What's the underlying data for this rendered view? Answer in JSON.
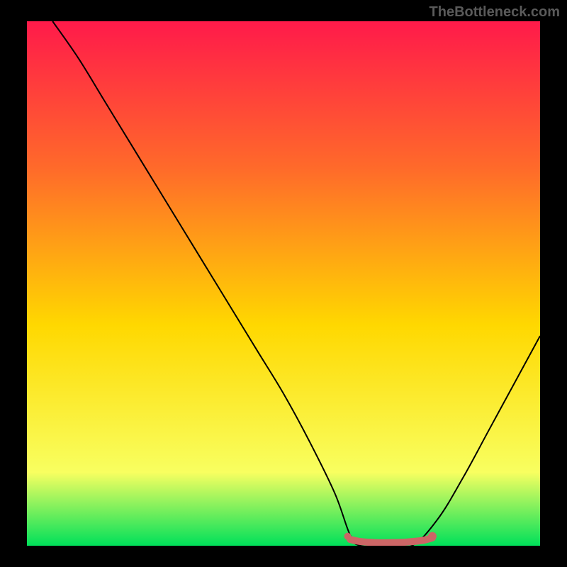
{
  "watermark": "TheBottleneck.com",
  "chart_data": {
    "type": "line",
    "title": "",
    "xlabel": "",
    "ylabel": "",
    "xlim": [
      0,
      100
    ],
    "ylim": [
      0,
      100
    ],
    "grid": false,
    "legend": false,
    "gradient_colors": {
      "top": "#ff1a4a",
      "mid1": "#ff6a2a",
      "mid2": "#ffd800",
      "low": "#f8ff60",
      "bottom": "#00e05a"
    },
    "series": [
      {
        "name": "bottleneck-curve",
        "x": [
          5,
          10,
          15,
          20,
          25,
          30,
          35,
          40,
          45,
          50,
          55,
          60,
          63,
          65,
          70,
          75,
          80,
          85,
          90,
          95,
          100
        ],
        "y": [
          100,
          93,
          85,
          77,
          69,
          61,
          53,
          45,
          37,
          29,
          20,
          10,
          2,
          0,
          0,
          0,
          5,
          13,
          22,
          31,
          40
        ],
        "color": "#000000",
        "stroke_width": 2
      },
      {
        "name": "optimal-range-marker",
        "x": [
          63,
          65,
          68,
          71,
          74,
          77,
          79
        ],
        "y": [
          1.2,
          0.8,
          0.6,
          0.6,
          0.7,
          1.0,
          1.5
        ],
        "color": "#cc6666",
        "stroke_width": 10,
        "linecap": "round"
      }
    ],
    "markers": [
      {
        "name": "optimal-start-dot",
        "x": 62.5,
        "y": 1.8,
        "r": 5,
        "color": "#cc6666"
      },
      {
        "name": "optimal-end-dot",
        "x": 79,
        "y": 1.8,
        "r": 6,
        "color": "#cc6666"
      }
    ]
  }
}
